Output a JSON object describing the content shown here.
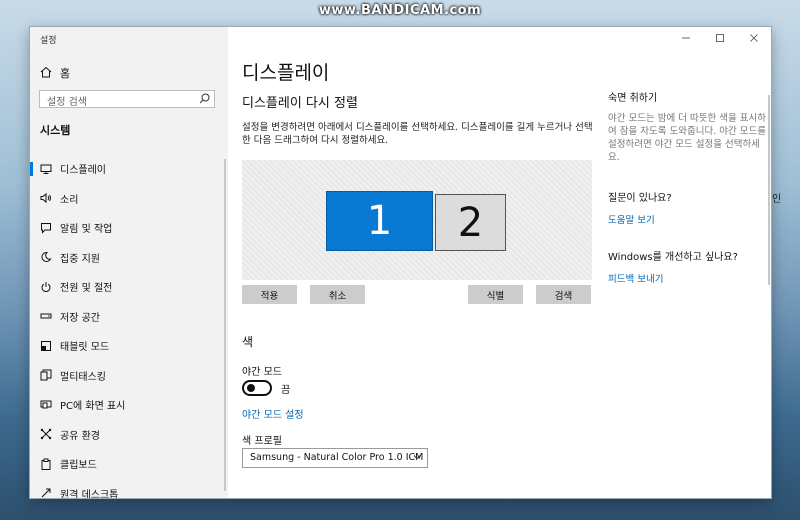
{
  "watermark": "www.BANDICAM.com",
  "desktop_text": "인",
  "window": {
    "title": "설정"
  },
  "sidebar": {
    "home": "홈",
    "search_placeholder": "설정 검색",
    "category": "시스템",
    "items": [
      {
        "label": "디스플레이",
        "icon": "monitor-icon",
        "active": true
      },
      {
        "label": "소리",
        "icon": "speaker-icon"
      },
      {
        "label": "알림 및 작업",
        "icon": "notification-icon"
      },
      {
        "label": "집중 지원",
        "icon": "moon-icon"
      },
      {
        "label": "전원 및 절전",
        "icon": "power-icon"
      },
      {
        "label": "저장 공간",
        "icon": "storage-icon"
      },
      {
        "label": "태블릿 모드",
        "icon": "tablet-icon"
      },
      {
        "label": "멀티태스킹",
        "icon": "multitask-icon"
      },
      {
        "label": "PC에 화면 표시",
        "icon": "project-icon"
      },
      {
        "label": "공유 환경",
        "icon": "share-icon"
      },
      {
        "label": "클립보드",
        "icon": "clipboard-icon"
      },
      {
        "label": "원격 데스크톱",
        "icon": "remote-icon"
      }
    ]
  },
  "main": {
    "title": "디스플레이",
    "section_title": "디스플레이 다시 정렬",
    "description": "설정을 변경하려면 아래에서 디스플레이를 선택하세요. 디스플레이를 길게 누르거나 선택한 다음 드래그하여 다시 정렬하세요.",
    "monitors": [
      "1",
      "2"
    ],
    "buttons": {
      "apply": "적용",
      "cancel": "취소",
      "identify": "식별",
      "detect": "검색"
    },
    "color_title": "색",
    "night_mode_label": "야간 모드",
    "night_mode_state": "끔",
    "night_mode_link": "야간 모드 설정",
    "color_profile_label": "색 프로필",
    "color_profile_value": "Samsung - Natural Color Pro 1.0 ICM"
  },
  "right_panel": {
    "sleep_title": "숙면 취하기",
    "sleep_desc": "야간 모드는 밤에 더 따뜻한 색을 표시하여 잠을 자도록 도와줍니다. 야간 모드를 설정하려면 야간 모드 설정을 선택하세요.",
    "question_title": "질문이 있나요?",
    "help_link": "도움말 보기",
    "improve_title": "Windows를 개선하고 싶나요?",
    "feedback_link": "피드백 보내기"
  },
  "colors": {
    "accent": "#0078d7",
    "monitor_selected": "#0a79d4",
    "link": "#0067b8"
  }
}
